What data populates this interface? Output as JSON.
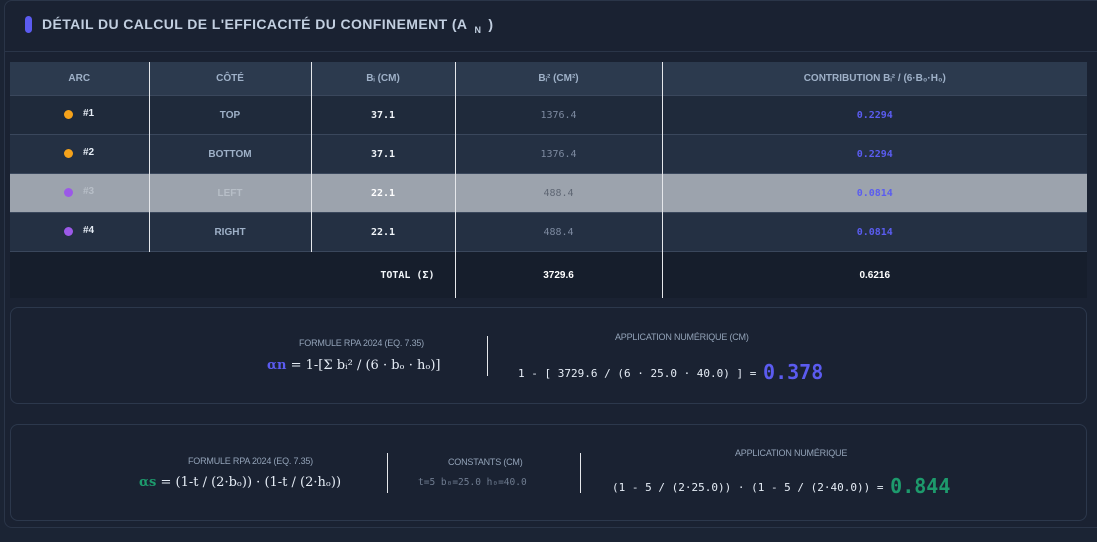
{
  "header": {
    "title": "DÉTAIL DU CALCUL DE L'EFFICACITÉ DU CONFINEMENT (A",
    "title_sub": "N",
    "title_close": ")"
  },
  "table": {
    "columns": [
      "ARC",
      "CÔTÉ",
      "Bᵢ (CM)",
      "Bᵢ² (CM²)",
      "CONTRIBUTION Bᵢ² / (6·B₀·H₀)"
    ],
    "rows": [
      {
        "arc": "#1",
        "side": "TOP",
        "bi": "37.1",
        "bi2": "1376.4",
        "contribution": "0.2294",
        "dot_color": "#f5a21b"
      },
      {
        "arc": "#2",
        "side": "BOTTOM",
        "bi": "37.1",
        "bi2": "1376.4",
        "contribution": "0.2294",
        "dot_color": "#f5a21b"
      },
      {
        "arc": "#3",
        "side": "LEFT",
        "bi": "22.1",
        "bi2": "488.4",
        "contribution": "0.0814",
        "dot_color": "#9b59e8"
      },
      {
        "arc": "#4",
        "side": "RIGHT",
        "bi": "22.1",
        "bi2": "488.4",
        "contribution": "0.0814",
        "dot_color": "#9b59e8"
      }
    ],
    "total_label": "TOTAL (Σ)",
    "total_bi2": "3729.6",
    "total_contribution": "0.6216"
  },
  "alpha_n": {
    "formula_caption": "FORMULE RPA 2024 (EQ. 7.35)",
    "symbol": "αn",
    "formula": "= 1-[Σ bᵢ² / (6 · bₒ · hₒ)]",
    "application_caption": "APPLICATION NUMÉRIQUE (CM)",
    "application": "1 - [ 3729.6 / (6 · 25.0 · 40.0) ] =",
    "result": "0.378"
  },
  "alpha_s": {
    "formula_caption": "FORMULE RPA 2024 (EQ. 7.35)",
    "symbol": "αs",
    "formula": "= (1-t / (2·bₒ)) · (1-t / (2·hₒ))",
    "constants_caption": "CONSTANTS (CM)",
    "constants": "t=5   b₀=25.0   h₀=40.0",
    "application_caption": "APPLICATION NUMÉRIQUE",
    "application": "(1 - 5 / (2·25.0)) · (1 - 5 / (2·40.0)) =",
    "result": "0.844"
  },
  "colors": {
    "accent_blue": "#5b5bf0",
    "accent_green": "#1d9a6c",
    "dot_orange": "#f5a21b",
    "dot_purple": "#9b59e8"
  }
}
